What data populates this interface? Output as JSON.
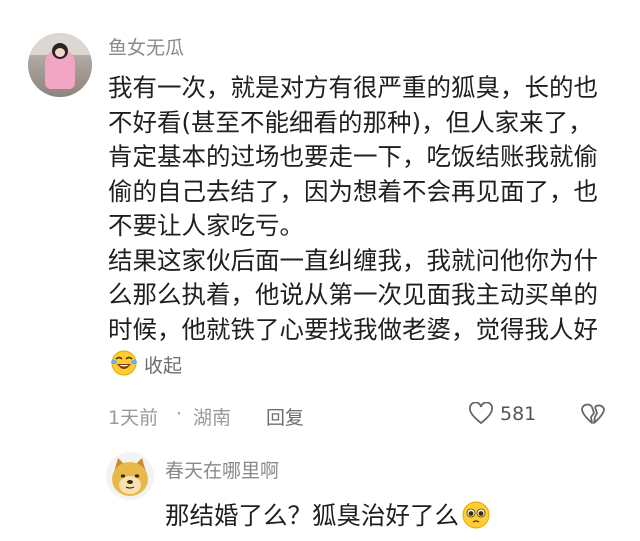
{
  "comment": {
    "username": "鱼女无瓜",
    "paragraphs": [
      "我有一次，就是对方有很严重的狐臭，长的也不好看(甚至不能细看的那种)，但人家来了，肯定基本的过场也要走一下，吃饭结账我就偷偷的自己去结了，因为想着不会再见面了，也不要让人家吃亏。",
      "结果这家伙后面一直纠缠我，我就问他你为什么那么执着，他说从第一次见面我主动买单的时候，他就铁了心要找我做老婆，觉得我人好"
    ],
    "emoji": "laughing-crying-emoji",
    "collapse_label": "收起",
    "time": "1天前",
    "separator": "·",
    "location": "湖南",
    "reply_label": "回复",
    "like_count": "581"
  },
  "reply": {
    "username": "春天在哪里啊",
    "text": "那结婚了么？狐臭治好了么",
    "emoji": "pleading-emoji"
  },
  "colors": {
    "text_primary": "#1f1f1f",
    "text_secondary": "#8a8a8a",
    "avatar_pink": "#f1a7c3",
    "doge_yellow": "#e8b94a"
  }
}
